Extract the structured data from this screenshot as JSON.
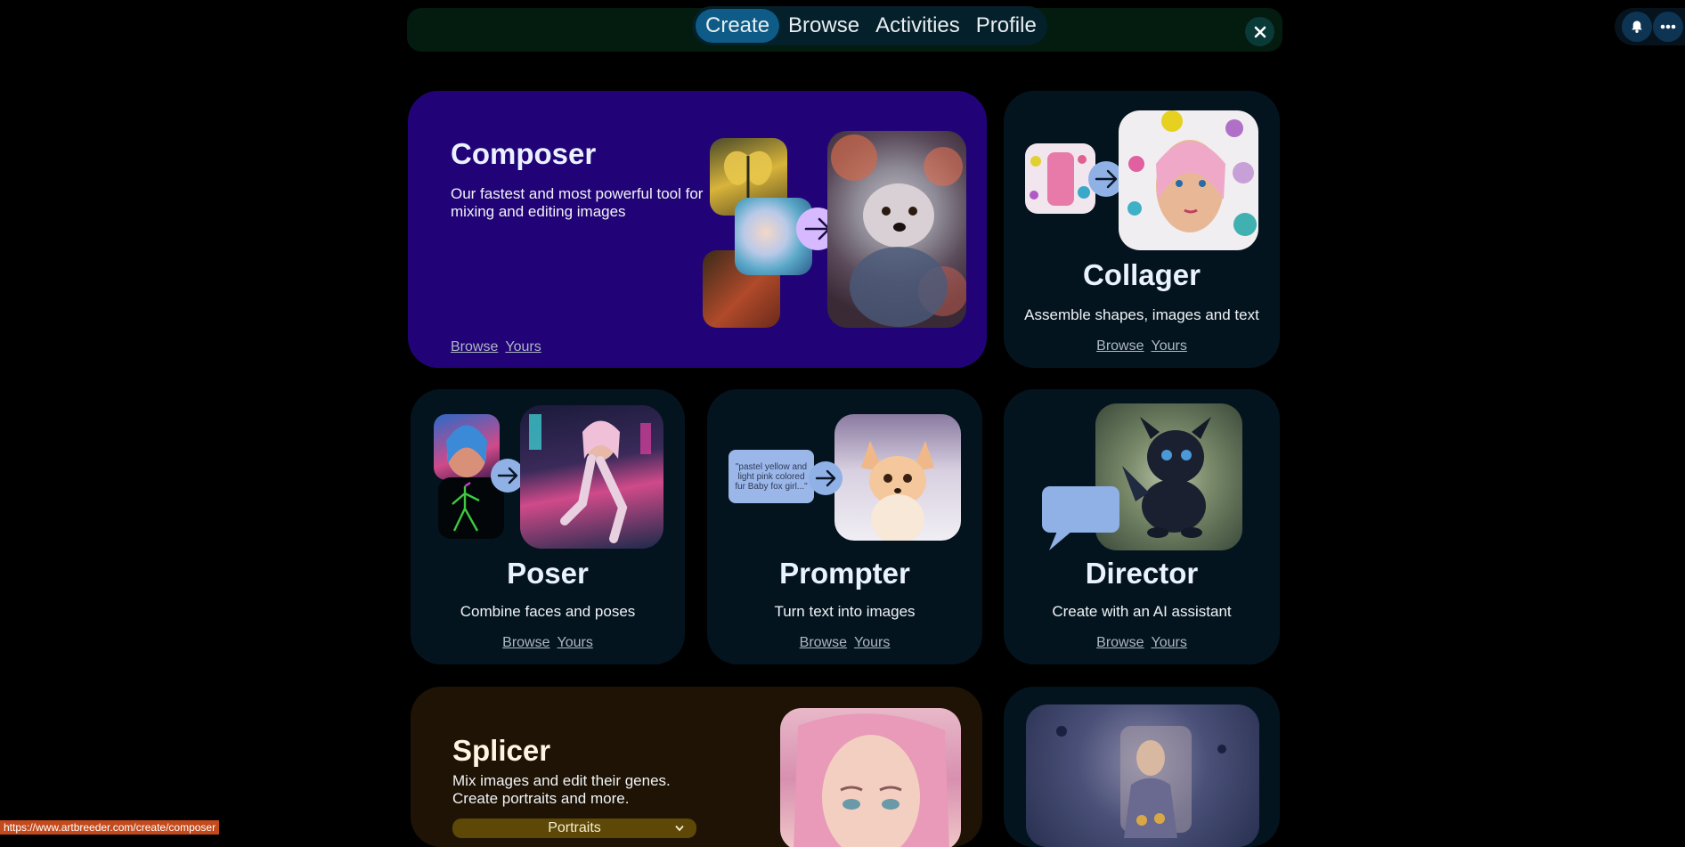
{
  "nav": {
    "tabs": [
      {
        "label": "Create",
        "active": true
      },
      {
        "label": "Browse",
        "active": false
      },
      {
        "label": "Activities",
        "active": false
      },
      {
        "label": "Profile",
        "active": false
      }
    ],
    "close_icon": "close-icon",
    "bell_icon": "bell-icon",
    "more_icon": "more-icon"
  },
  "cards": {
    "composer": {
      "title": "Composer",
      "desc": "Our fastest and most powerful tool for mixing and editing images",
      "browse": "Browse",
      "yours": "Yours"
    },
    "collager": {
      "title": "Collager",
      "desc": "Assemble shapes, images and text",
      "browse": "Browse",
      "yours": "Yours"
    },
    "poser": {
      "title": "Poser",
      "desc": "Combine faces and poses",
      "browse": "Browse",
      "yours": "Yours"
    },
    "prompter": {
      "title": "Prompter",
      "desc": "Turn text into images",
      "browse": "Browse",
      "yours": "Yours",
      "bubble": "\"pastel yellow and light pink colored fur Baby fox girl...\""
    },
    "director": {
      "title": "Director",
      "desc": "Create with an AI assistant",
      "browse": "Browse",
      "yours": "Yours"
    },
    "splicer": {
      "title": "Splicer",
      "desc_line1": "Mix images and edit their genes.",
      "desc_line2": "Create portraits and more.",
      "dropdown": "Portraits"
    }
  },
  "status_url": "https://www.artbreeder.com/create/composer",
  "colors": {
    "composer_bg": "#220377",
    "splicer_bg": "#1e1304",
    "card_bg": "#04141f",
    "accent": "#0d5b86"
  }
}
